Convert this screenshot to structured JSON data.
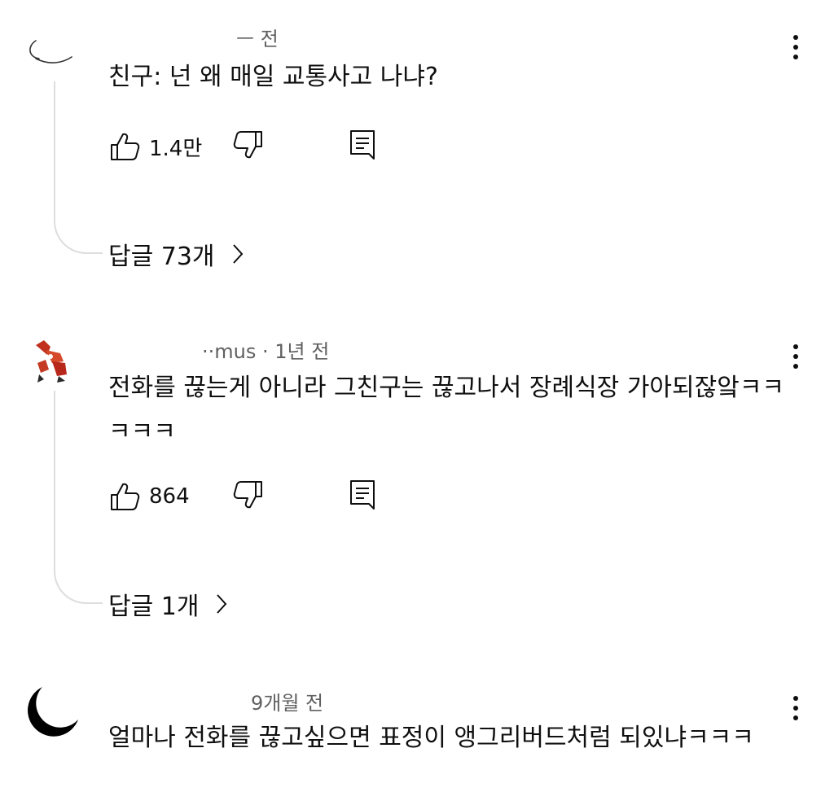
{
  "comments": [
    {
      "meta": "ㅡ 전",
      "text": "친구: 넌 왜 매일 교통사고 나냐?",
      "likes": "1.4만",
      "replies": "답글 73개"
    },
    {
      "meta": "··mus · 1년 전",
      "text": "전화를 끊는게 아니라 그친구는 끊고나서 장례식장 가아되잖앜ㅋㅋㅋㅋㅋ",
      "likes": "864",
      "replies": "답글 1개"
    },
    {
      "meta": "9개월 전",
      "text": "얼마나 전화를 끊고싶으면 표정이 앵그리버드처럼 되있냐ㅋㅋㅋ"
    }
  ],
  "icons": {
    "like": "thumbs-up-icon",
    "dislike": "thumbs-down-icon",
    "reply": "comment-reply-icon",
    "more": "more-vertical-icon",
    "chevron": "chevron-right-icon"
  }
}
